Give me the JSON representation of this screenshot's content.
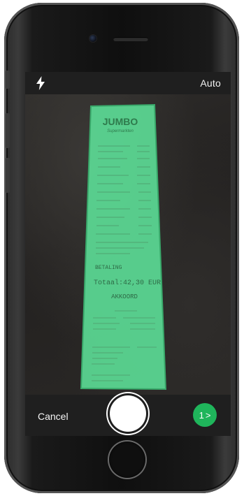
{
  "topbar": {
    "flash_icon": "flash-icon",
    "mode_label": "Auto"
  },
  "receipt": {
    "store_name": "JUMBO",
    "store_tagline": "Supermarkten",
    "section_label": "BETALING",
    "total_label": "Totaal:",
    "total_value": "42,30 EUR",
    "status": "AKKOORD",
    "highlight_color": "#5de39a"
  },
  "bottombar": {
    "cancel_label": "Cancel",
    "next_count": "1",
    "next_icon": ">",
    "accent_color": "#1fb55b"
  }
}
